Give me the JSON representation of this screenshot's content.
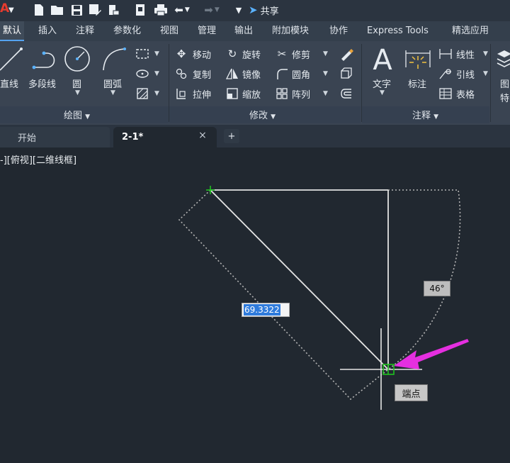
{
  "quick_access": {
    "logo": "A",
    "share_label": "共享",
    "icons": [
      "new-icon",
      "open-icon",
      "save-icon",
      "save-as-icon",
      "cloud-icon",
      "sheet-icon",
      "print-icon",
      "undo-icon",
      "redo-icon",
      "customize-icon",
      "share-icon"
    ]
  },
  "ribbon_tabs": [
    {
      "label": "默认",
      "active": true
    },
    {
      "label": "插入"
    },
    {
      "label": "注释"
    },
    {
      "label": "参数化"
    },
    {
      "label": "视图"
    },
    {
      "label": "管理"
    },
    {
      "label": "输出"
    },
    {
      "label": "附加模块"
    },
    {
      "label": "协作"
    },
    {
      "label": "Express Tools"
    },
    {
      "label": "精选应用"
    }
  ],
  "draw_panel": {
    "title": "绘图",
    "tools": [
      {
        "label": "直线",
        "icon": "line-icon"
      },
      {
        "label": "多段线",
        "icon": "polyline-icon"
      },
      {
        "label": "圆",
        "icon": "circle-icon"
      },
      {
        "label": "圆弧",
        "icon": "arc-icon"
      }
    ]
  },
  "modify_panel": {
    "title": "修改",
    "tools": [
      {
        "label": "移动",
        "icon": "move-icon"
      },
      {
        "label": "旋转",
        "icon": "rotate-icon"
      },
      {
        "label": "修剪",
        "icon": "trim-icon"
      },
      {
        "label": "复制",
        "icon": "copy-icon"
      },
      {
        "label": "镜像",
        "icon": "mirror-icon"
      },
      {
        "label": "圆角",
        "icon": "fillet-icon"
      },
      {
        "label": "拉伸",
        "icon": "stretch-icon"
      },
      {
        "label": "缩放",
        "icon": "scale-icon"
      },
      {
        "label": "阵列",
        "icon": "array-icon"
      }
    ]
  },
  "annotation_panel": {
    "title": "注释",
    "text_label": "文字",
    "dimension_label": "标注",
    "linear_label": "线性",
    "leader_label": "引线",
    "table_label": "表格"
  },
  "partial_panel": {
    "line1": "图",
    "line2": "特"
  },
  "document_tabs": {
    "start_label": "开始",
    "drawing_label": "2-1*",
    "close_glyph": "×",
    "add_glyph": "+"
  },
  "viewport": {
    "label": "-][俯视][二维线框]",
    "dimension_value": "69.3322",
    "angle_value": "46°",
    "snap_tooltip": "端点"
  },
  "colors": {
    "canvas_bg": "#212830",
    "geometry_line": "#e3e3e3",
    "dotted_line": "#b9b9b9",
    "snap_marker": "#1fc21f",
    "arrow_annotation": "#e52fe0",
    "selection_blue": "#2f7bdc"
  }
}
